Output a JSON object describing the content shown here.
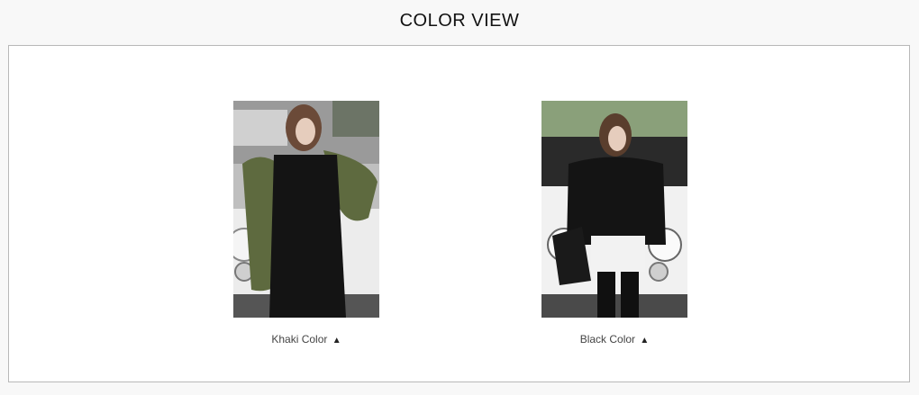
{
  "header": {
    "title": "COLOR VIEW"
  },
  "colors": [
    {
      "label": "Khaki Color",
      "arrow": "▲",
      "swatch": "#5e6a3f"
    },
    {
      "label": "Black Color",
      "arrow": "▲",
      "swatch": "#151515"
    }
  ]
}
